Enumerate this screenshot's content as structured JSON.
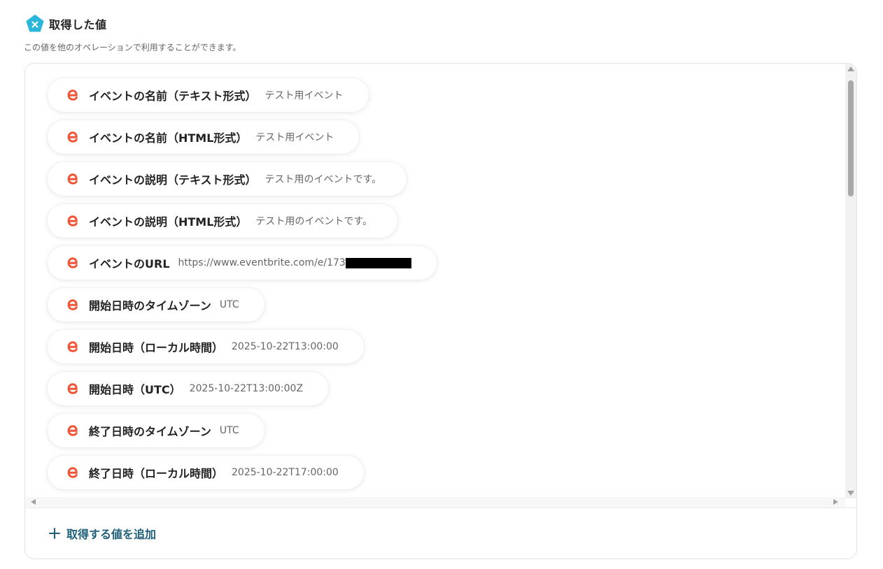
{
  "header": {
    "title": "取得した値",
    "subtitle": "この値を他のオペレーションで利用することができます。"
  },
  "items": [
    {
      "label": "イベントの名前（テキスト形式）",
      "value": "テスト用イベント"
    },
    {
      "label": "イベントの名前（HTML形式）",
      "value": "テスト用イベント"
    },
    {
      "label": "イベントの説明（テキスト形式）",
      "value": "テスト用のイベントです。"
    },
    {
      "label": "イベントの説明（HTML形式）",
      "value": "テスト用のイベントです。"
    },
    {
      "label": "イベントのURL",
      "value": "https://www.eventbrite.com/e/173"
    },
    {
      "label": "開始日時のタイムゾーン",
      "value": "UTC"
    },
    {
      "label": "開始日時（ローカル時間）",
      "value": "2025-10-22T13:00:00"
    },
    {
      "label": "開始日時（UTC）",
      "value": "2025-10-22T13:00:00Z"
    },
    {
      "label": "終了日時のタイムゾーン",
      "value": "UTC"
    },
    {
      "label": "終了日時（ローカル時間）",
      "value": "2025-10-22T17:00:00"
    }
  ],
  "footer": {
    "add_label": "取得する値を追加"
  },
  "colors": {
    "header_icon": "#2bb6d9",
    "eventbrite_orange": "#f05537",
    "add_text": "#1f5f78"
  },
  "icons": {
    "header": "pentagon-x-icon",
    "item": "eventbrite-e-icon",
    "add": "plus-icon"
  }
}
